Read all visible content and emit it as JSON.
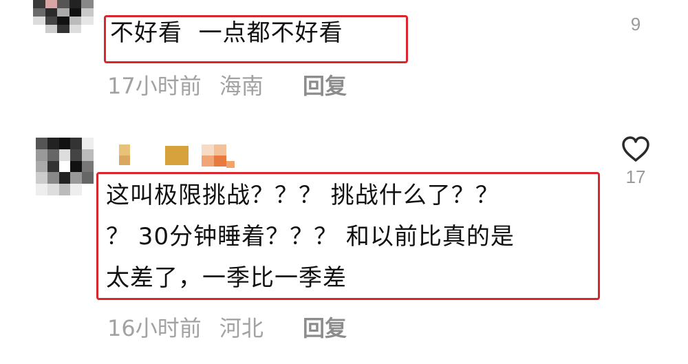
{
  "comments": [
    {
      "text": "不好看  一点都不好看",
      "time": "17小时前",
      "location": "海南",
      "reply_label": "回复",
      "like_count": "9"
    },
    {
      "text": "这叫极限挑战？？？ 挑战什么了？？\n？ 30分钟睡着？？？ 和以前比真的是\n太差了，一季比一季差",
      "time": "16小时前",
      "location": "河北",
      "reply_label": "回复",
      "like_count": "17"
    }
  ],
  "colors": {
    "highlight_border": "#d9262c",
    "meta_text": "#a2a2a2",
    "reply_text": "#8c8c8c"
  },
  "icons": {
    "like": "heart-outline-icon",
    "avatar": "pixelated-avatar"
  }
}
